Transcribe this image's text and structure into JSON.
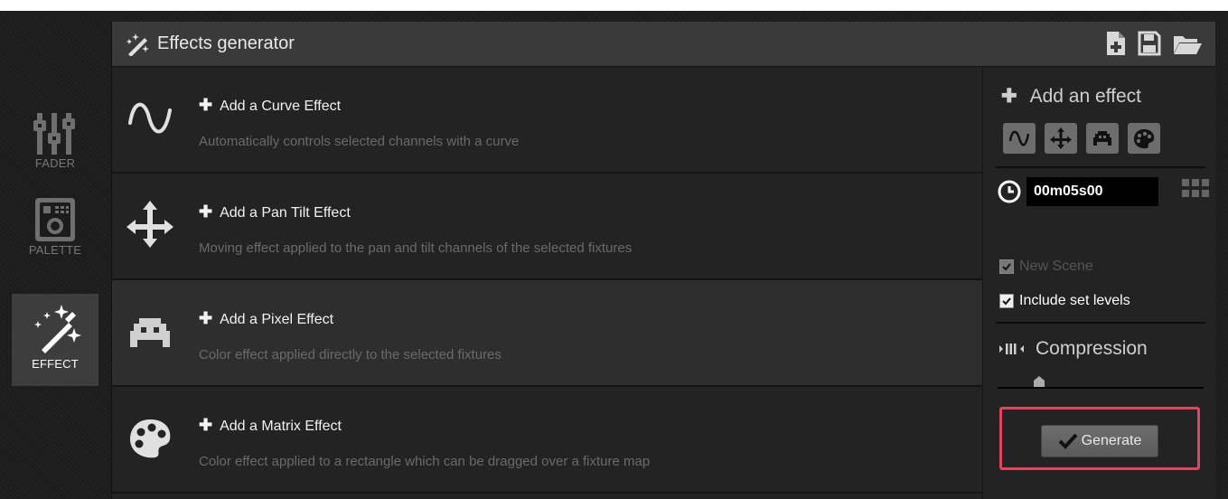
{
  "side_menu": {
    "items": [
      {
        "label": "FADER",
        "icon": "fader-icon",
        "active": false
      },
      {
        "label": "PALETTE",
        "icon": "palette-icon",
        "active": false
      },
      {
        "label": "EFFECT",
        "icon": "magic-wand-icon",
        "active": true
      }
    ]
  },
  "panel": {
    "title": "Effects generator",
    "header_icons": [
      "new-file-icon",
      "save-icon",
      "open-folder-icon"
    ]
  },
  "effects": [
    {
      "title": "Add a Curve Effect",
      "description": "Automatically controls selected channels with a curve",
      "icon": "curve-icon"
    },
    {
      "title": "Add a Pan Tilt Effect",
      "description": "Moving effect applied to the pan and tilt channels of the selected fixtures",
      "icon": "move-arrows-icon"
    },
    {
      "title": "Add a Pixel Effect",
      "description": "Color effect applied directly to the selected fixtures",
      "icon": "space-invader-icon"
    },
    {
      "title": "Add a Matrix Effect",
      "description": "Color effect applied to a rectangle which can be dragged over a fixture map",
      "icon": "palette-icon"
    }
  ],
  "right_panel": {
    "add_effect_label": "Add an effect",
    "duration": "00m05s00",
    "new_scene_label": "New Scene",
    "new_scene_checked": true,
    "new_scene_disabled": true,
    "include_levels_label": "Include set levels",
    "include_levels_checked": true,
    "compression_label": "Compression",
    "compression_value": 0.2,
    "generate_label": "Generate"
  },
  "colors": {
    "highlight": "#e0455f",
    "header": "#3a3a3a",
    "background": "#232323"
  }
}
